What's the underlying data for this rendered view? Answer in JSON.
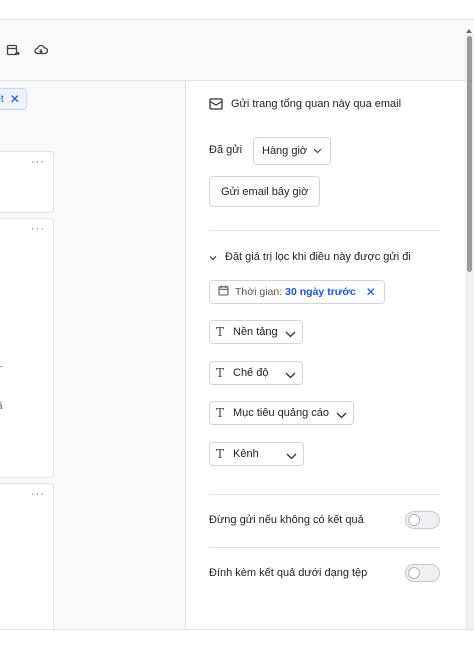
{
  "left": {
    "filter_chip_text": "ết",
    "card_more": "···",
    "card_fragments": [
      "–",
      "ã"
    ]
  },
  "email": {
    "title": "Gửi trang tổng quan này qua email",
    "sent_label": "Đã gửi",
    "frequency": "Hàng giờ",
    "send_now": "Gửi email bây giờ"
  },
  "filters": {
    "header": "Đặt giá trị lọc khi điều này được gửi đi",
    "time_label": "Thời gian:",
    "time_value": "30 ngày trước",
    "dimensions": [
      "Nền tảng",
      "Chế độ",
      "Mục tiêu quảng cáo",
      "Kênh"
    ]
  },
  "options": {
    "stop_if_empty": "Đừng gửi nếu không có kết quả",
    "stop_if_empty_on": false,
    "attach_as_file": "Đính kèm kết quả dưới dạng tệp",
    "attach_as_file_on": false
  },
  "icons": [
    "calendar-export-icon",
    "cloud-download-icon",
    "mail-icon",
    "chevron-down-icon",
    "calendar-icon",
    "close-icon",
    "text-type-icon"
  ],
  "colors": {
    "accent": "#1a57d6",
    "panel_bg": "#f8f9fb",
    "border": "#e3e3e3"
  }
}
